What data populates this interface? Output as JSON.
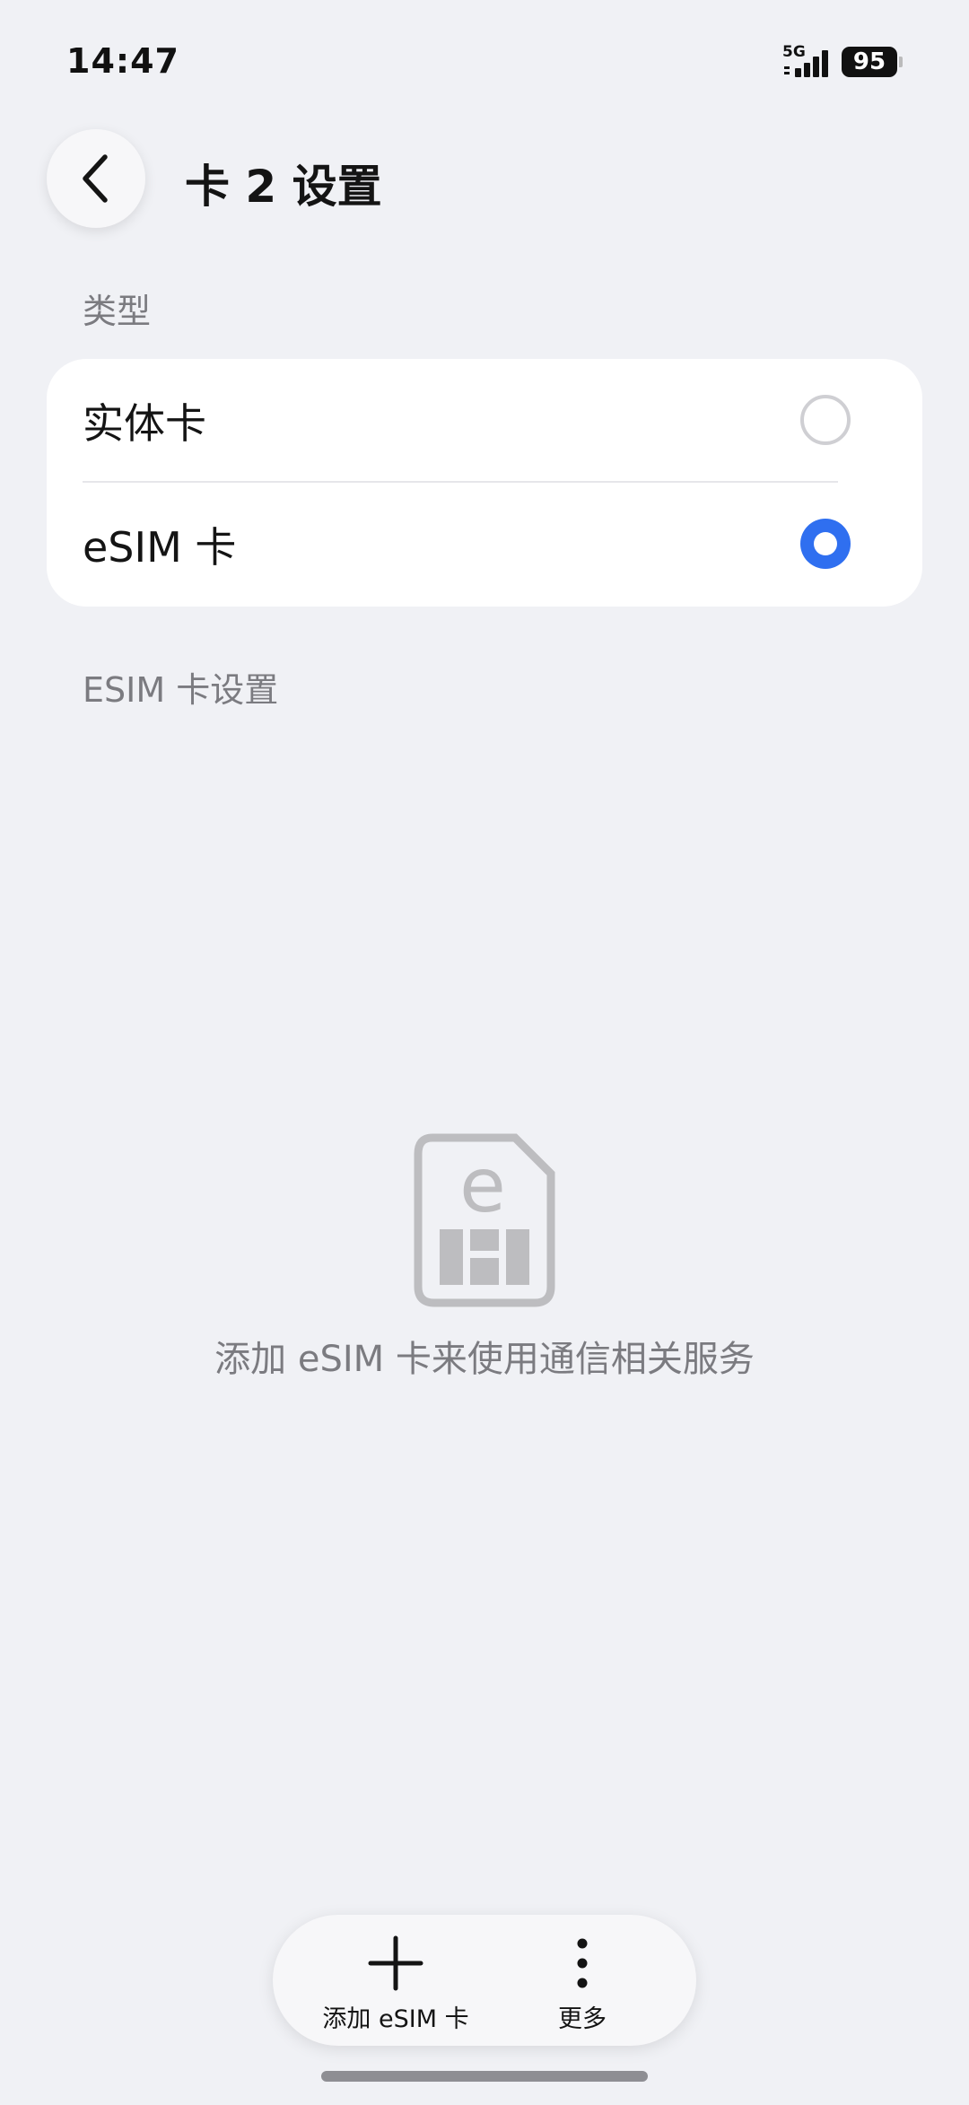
{
  "status_bar": {
    "time": "14:47",
    "network": "5G",
    "battery": "95",
    "signal_icon": "signal-bars-icon"
  },
  "header": {
    "back_icon": "chevron-left-icon",
    "title": "卡 2 设置"
  },
  "type_section": {
    "label": "类型",
    "options": [
      {
        "label": "实体卡",
        "selected": false
      },
      {
        "label": "eSIM 卡",
        "selected": true
      }
    ]
  },
  "esim_section": {
    "label": "ESIM 卡设置",
    "empty_icon": "esim-card-icon",
    "empty_text": "添加 eSIM 卡来使用通信相关服务"
  },
  "toolbar": {
    "add_label": "添加 eSIM 卡",
    "add_icon": "plus-icon",
    "more_label": "更多",
    "more_icon": "more-vertical-icon"
  },
  "colors": {
    "background": "#f0f1f5",
    "card": "#ffffff",
    "accent": "#2f6ff0",
    "secondary_text": "#7b7b80"
  }
}
